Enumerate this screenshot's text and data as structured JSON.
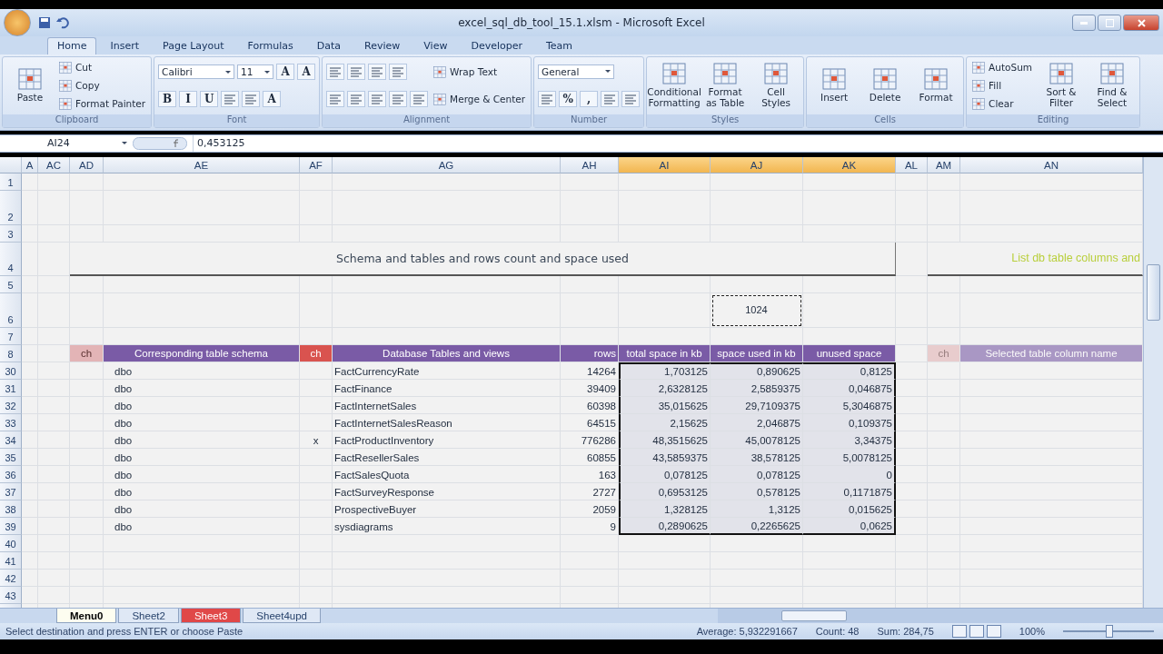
{
  "window": {
    "title": "excel_sql_db_tool_15.1.xlsm - Microsoft Excel"
  },
  "ribbon_tabs": [
    {
      "label": "Home",
      "selected": true
    },
    {
      "label": "Insert",
      "selected": false
    },
    {
      "label": "Page Layout",
      "selected": false
    },
    {
      "label": "Formulas",
      "selected": false
    },
    {
      "label": "Data",
      "selected": false
    },
    {
      "label": "Review",
      "selected": false
    },
    {
      "label": "View",
      "selected": false
    },
    {
      "label": "Developer",
      "selected": false
    },
    {
      "label": "Team",
      "selected": false
    }
  ],
  "ribbon_groups": [
    {
      "label": "Clipboard",
      "columns": [
        [
          {
            "kind": "large",
            "label": "Paste"
          }
        ],
        [
          {
            "kind": "small",
            "label": "Cut"
          },
          {
            "kind": "small",
            "label": "Copy"
          },
          {
            "kind": "small",
            "label": "Format Painter"
          }
        ]
      ]
    },
    {
      "label": "Font",
      "columns": [
        [
          {
            "kind": "row",
            "items": [
              {
                "kind": "field",
                "value": "Calibri"
              },
              {
                "kind": "spin",
                "value": "11"
              },
              {
                "kind": "glyph",
                "label": "A"
              },
              {
                "kind": "glyph",
                "label": "A"
              }
            ]
          },
          {
            "kind": "row",
            "items": [
              {
                "kind": "glyph",
                "label": "B"
              },
              {
                "kind": "glyph",
                "label": "I"
              },
              {
                "kind": "glyph",
                "label": "U"
              },
              {
                "kind": "icon"
              },
              {
                "kind": "icon"
              },
              {
                "kind": "glyph",
                "label": "A"
              }
            ]
          }
        ]
      ]
    },
    {
      "label": "Alignment",
      "columns": [
        [
          {
            "kind": "row",
            "items": [
              {
                "kind": "icon"
              },
              {
                "kind": "icon"
              },
              {
                "kind": "icon"
              },
              {
                "kind": "icon"
              }
            ]
          },
          {
            "kind": "row",
            "items": [
              {
                "kind": "icon"
              },
              {
                "kind": "icon"
              },
              {
                "kind": "icon"
              },
              {
                "kind": "icon"
              },
              {
                "kind": "icon"
              }
            ]
          }
        ],
        [
          {
            "kind": "small",
            "label": "Wrap Text"
          },
          {
            "kind": "small",
            "label": "Merge & Center"
          }
        ]
      ]
    },
    {
      "label": "Number",
      "columns": [
        [
          {
            "kind": "row",
            "items": [
              {
                "kind": "field",
                "value": "General"
              }
            ]
          },
          {
            "kind": "row",
            "items": [
              {
                "kind": "icon"
              },
              {
                "kind": "glyph",
                "label": "%"
              },
              {
                "kind": "glyph",
                "label": ","
              },
              {
                "kind": "icon"
              },
              {
                "kind": "icon"
              }
            ]
          }
        ]
      ]
    },
    {
      "label": "Styles",
      "columns": [
        [
          {
            "kind": "large",
            "label": "Conditional Formatting"
          }
        ],
        [
          {
            "kind": "large",
            "label": "Format as Table"
          }
        ],
        [
          {
            "kind": "large",
            "label": "Cell Styles"
          }
        ]
      ]
    },
    {
      "label": "Cells",
      "columns": [
        [
          {
            "kind": "large",
            "label": "Insert"
          }
        ],
        [
          {
            "kind": "large",
            "label": "Delete"
          }
        ],
        [
          {
            "kind": "large",
            "label": "Format"
          }
        ]
      ]
    },
    {
      "label": "Editing",
      "columns": [
        [
          {
            "kind": "small",
            "label": "AutoSum"
          },
          {
            "kind": "small",
            "label": "Fill"
          },
          {
            "kind": "small",
            "label": "Clear"
          }
        ],
        [
          {
            "kind": "large",
            "label": "Sort & Filter"
          }
        ],
        [
          {
            "kind": "large",
            "label": "Find & Select"
          }
        ]
      ]
    }
  ],
  "name_box": "AI24",
  "formula": "0,453125",
  "columns": [
    {
      "label": "A",
      "selected": false
    },
    {
      "label": "AC",
      "selected": false
    },
    {
      "label": "AD",
      "selected": false
    },
    {
      "label": "AE",
      "selected": false
    },
    {
      "label": "AF",
      "selected": false
    },
    {
      "label": "AG",
      "selected": false
    },
    {
      "label": "AH",
      "selected": false
    },
    {
      "label": "AI",
      "selected": true
    },
    {
      "label": "AJ",
      "selected": true
    },
    {
      "label": "AK",
      "selected": true
    },
    {
      "label": "AL",
      "selected": false
    },
    {
      "label": "AM",
      "selected": false
    },
    {
      "label": "AN",
      "selected": false
    }
  ],
  "top_row_numbers": [
    "1",
    "2",
    "3",
    "4",
    "5",
    "6",
    "7",
    "8"
  ],
  "title": "Schema and tables and rows count and space used",
  "side_title": "List db table columns and",
  "copied_cell": "1024",
  "header": {
    "ch_1": "ch",
    "schema": "Corresponding table schema",
    "ch_2": "ch",
    "table": "Database Tables and views",
    "rows": "rows",
    "total": "total space in kb",
    "used": "space used in kb",
    "unused": "unused space"
  },
  "side_header": {
    "ch": "ch",
    "column": "Selected table column name"
  },
  "data": [
    {
      "number": "30",
      "schema": "dbo",
      "table": "FactCurrencyRate",
      "rows": "14264",
      "total": "1,703125",
      "used": "0,890625",
      "unused": "0,8125",
      "selected": true
    },
    {
      "number": "31",
      "schema": "dbo",
      "table": "FactFinance",
      "rows": "39409",
      "total": "2,6328125",
      "used": "2,5859375",
      "unused": "0,046875",
      "selected": true
    },
    {
      "number": "32",
      "schema": "dbo",
      "table": "FactInternetSales",
      "rows": "60398",
      "total": "35,015625",
      "used": "29,7109375",
      "unused": "5,3046875",
      "selected": true
    },
    {
      "number": "33",
      "schema": "dbo",
      "table": "FactInternetSalesReason",
      "rows": "64515",
      "total": "2,15625",
      "used": "2,046875",
      "unused": "0,109375",
      "selected": true
    },
    {
      "number": "34",
      "schema": "dbo",
      "flag": "x",
      "table": "FactProductInventory",
      "rows": "776286",
      "total": "48,3515625",
      "used": "45,0078125",
      "unused": "3,34375",
      "selected": true
    },
    {
      "number": "35",
      "schema": "dbo",
      "table": "FactResellerSales",
      "rows": "60855",
      "total": "43,5859375",
      "used": "38,578125",
      "unused": "5,0078125",
      "selected": true
    },
    {
      "number": "36",
      "schema": "dbo",
      "table": "FactSalesQuota",
      "rows": "163",
      "total": "0,078125",
      "used": "0,078125",
      "unused": "0",
      "selected": true
    },
    {
      "number": "37",
      "schema": "dbo",
      "table": "FactSurveyResponse",
      "rows": "2727",
      "total": "0,6953125",
      "used": "0,578125",
      "unused": "0,1171875",
      "selected": true
    },
    {
      "number": "38",
      "schema": "dbo",
      "table": "ProspectiveBuyer",
      "rows": "2059",
      "total": "1,328125",
      "used": "1,3125",
      "unused": "0,015625",
      "selected": true
    },
    {
      "number": "39",
      "schema": "dbo",
      "table": "sysdiagrams",
      "rows": "9",
      "total": "0,2890625",
      "used": "0,2265625",
      "unused": "0,0625",
      "selected": true
    }
  ],
  "bottom_row_numbers": [
    "40",
    "41",
    "42",
    "43"
  ],
  "sheet_tabs": [
    {
      "label": "Menu0",
      "selected": true
    },
    {
      "label": "Sheet2",
      "selected": false
    },
    {
      "label": "Sheet3",
      "selected": false,
      "color": "#e04848"
    },
    {
      "label": "Sheet4upd",
      "selected": false
    }
  ],
  "status_bar": {
    "message": "Select destination and press ENTER or choose Paste",
    "average": "Average: 5,932291667",
    "count": "Count: 48",
    "sum": "Sum: 284,75",
    "zoom": "100%",
    "zoom_slider": {
      "level": 0.5
    }
  }
}
